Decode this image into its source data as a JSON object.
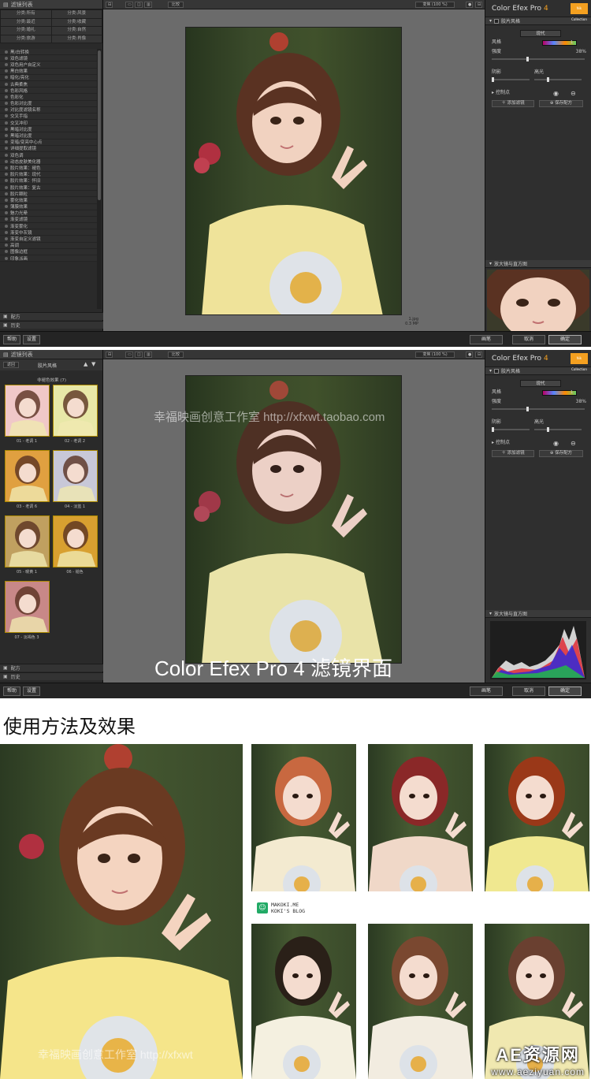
{
  "screen1": {
    "left_panel": {
      "header": "滤镜列表",
      "categories": [
        "分类:所有",
        "分类:风景",
        "分类:最近",
        "分类:收藏",
        "分类:婚礼",
        "分类:自然",
        "分类:旅游",
        "分类:肖像"
      ],
      "filters": [
        "黑/白转换",
        "双色滤镜",
        "双色用户自定义",
        "黑白效果",
        "暗化/亮化",
        "古典柔焦",
        "色彩风格",
        "色彩化",
        "色彩对比度",
        "对比度滤镜名称",
        "交叉手指",
        "交叉冲印",
        "黑暗对比度",
        "黑暗对比度",
        "变暗/变亮中心点",
        "详细提取滤镜",
        "双色调",
        "动态皮肤美化器",
        "胶片效果：褪色",
        "胶片效果：现代",
        "胶片效果：怀旧",
        "胶片效果：复古",
        "胶片颗粒",
        "雾化效果",
        "薄膜效果",
        "魅力光晕",
        "渐变滤镜",
        "渐变雾化",
        "渐变中灰镜",
        "渐变自定义滤镜",
        "高调",
        "图像边框",
        "印象派画"
      ],
      "footer_recipes": "配方",
      "footer_history": "历史"
    },
    "toolbar": {
      "compare": "比较",
      "zoom": "变焦 (100 %)"
    },
    "canvas_info": {
      "filename": "1.jpg",
      "size": "0.3 MP"
    },
    "right_panel": {
      "title_app": "Color Efex Pro",
      "title_ver": "4",
      "logo": "Nik Collection",
      "section": "胶片风格",
      "select_value": "现代",
      "style_label": "风格",
      "style_num": "1",
      "strength_label": "强度",
      "strength_value": "38%",
      "shadows_label": "阴影",
      "highlights_label": "高光",
      "control_points": "控制点",
      "add_filter": "添加滤镜",
      "save_recipe": "保存配方",
      "loupe": "放大镜与直方图"
    },
    "bottom": {
      "help": "帮助",
      "settings": "设置",
      "brush": "画笔",
      "cancel": "取消",
      "ok": "确定"
    }
  },
  "screen2": {
    "left_panel": {
      "header": "滤镜列表",
      "back": "返回",
      "category": "胶片风格",
      "group_title": "非褪色效果 (7)",
      "presets": [
        "01 - 老调 1",
        "02 - 老调 2",
        "03 - 老调 6",
        "04 - 淡蓝 1",
        "05 - 暖黄 1",
        "06 - 褪色",
        "07 - 淡褐色 3"
      ],
      "footer_recipes": "配方",
      "footer_history": "历史"
    },
    "toolbar": {
      "compare": "比较",
      "zoom": "变焦 (100 %)"
    },
    "right_panel": {
      "title_app": "Color Efex Pro",
      "title_ver": "4",
      "section": "胶片风格",
      "select_value": "现代",
      "style_label": "风格",
      "style_num": "1",
      "strength_label": "强度",
      "strength_value": "38%",
      "shadows_label": "阴影",
      "highlights_label": "高光",
      "control_points": "控制点",
      "add_filter": "添加滤镜",
      "save_recipe": "保存配方",
      "loupe": "放大镜与直方图"
    },
    "watermark": "幸福映画创意工作室 http://xfxwt.taobao.com",
    "overlay_title": "Color Efex Pro 4 滤镜界面",
    "bottom": {
      "help": "帮助",
      "settings": "设置",
      "brush": "画笔",
      "cancel": "取消",
      "ok": "确定"
    }
  },
  "usage": {
    "title": "使用方法及效果",
    "watermark": "幸福映画创意工作室 http://xfxwt",
    "blog_line1": "MAKOKI.ME",
    "blog_line2": "KOKI'S BLOG",
    "brand_line1": "AE资源网",
    "brand_line2": "www.aeziyuan.com"
  },
  "colors": {
    "accent": "#f4a020",
    "panel": "#2e2e2e",
    "canvas": "#6b6b6b"
  }
}
